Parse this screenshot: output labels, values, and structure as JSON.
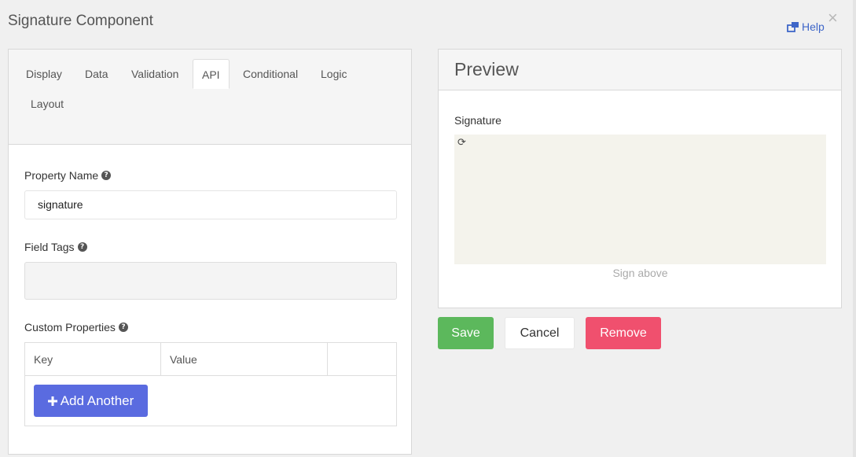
{
  "modal": {
    "title": "Signature Component",
    "help_label": "Help",
    "close_glyph": "×"
  },
  "tabs": [
    {
      "label": "Display",
      "active": false
    },
    {
      "label": "Data",
      "active": false
    },
    {
      "label": "Validation",
      "active": false
    },
    {
      "label": "API",
      "active": true
    },
    {
      "label": "Conditional",
      "active": false
    },
    {
      "label": "Logic",
      "active": false
    },
    {
      "label": "Layout",
      "active": false
    }
  ],
  "form": {
    "property_name_label": "Property Name",
    "property_name_value": "signature",
    "field_tags_label": "Field Tags",
    "custom_properties_label": "Custom Properties",
    "table_headers": [
      "Key",
      "Value",
      ""
    ],
    "add_another_label": "Add Another"
  },
  "preview": {
    "heading": "Preview",
    "signature_label": "Signature",
    "refresh_glyph": "⟳",
    "sign_above": "Sign above"
  },
  "actions": {
    "save": "Save",
    "cancel": "Cancel",
    "remove": "Remove"
  },
  "colors": {
    "save": "#5cb85c",
    "remove": "#f0506e",
    "add_another": "#5a6be0",
    "help_link": "#3e66c8"
  }
}
